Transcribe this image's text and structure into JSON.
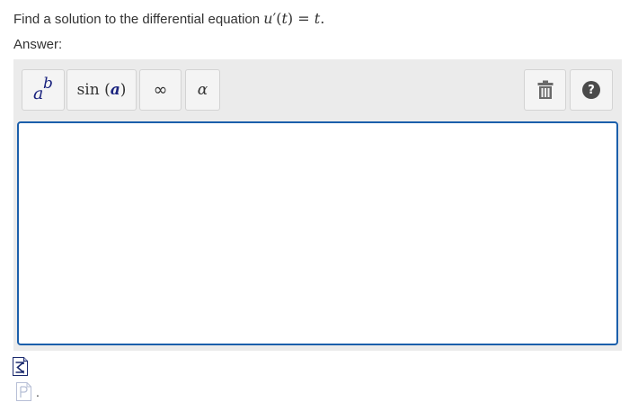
{
  "question": {
    "text": "Find a solution to the differential equation",
    "equation": {
      "func": "u",
      "prime": "′",
      "var": "t",
      "rhs": "t",
      "period": "."
    }
  },
  "answer_label": "Answer:",
  "toolbar": {
    "power": {
      "base": "a",
      "exponent": "b"
    },
    "sin": {
      "fn": "sin",
      "open": "(",
      "arg": "a",
      "close": ")"
    },
    "infinity": "∞",
    "alpha": "α",
    "help": "?"
  },
  "input": {
    "value": ""
  },
  "footer": {
    "dot": "."
  },
  "icons": [
    "power-template-icon",
    "trash-icon",
    "help-icon",
    "equation-sigma-icon",
    "page-icon"
  ],
  "colors": {
    "focus_border": "#1b5fab",
    "panel_bg": "#ebebeb",
    "math_var": "#1a237e"
  }
}
